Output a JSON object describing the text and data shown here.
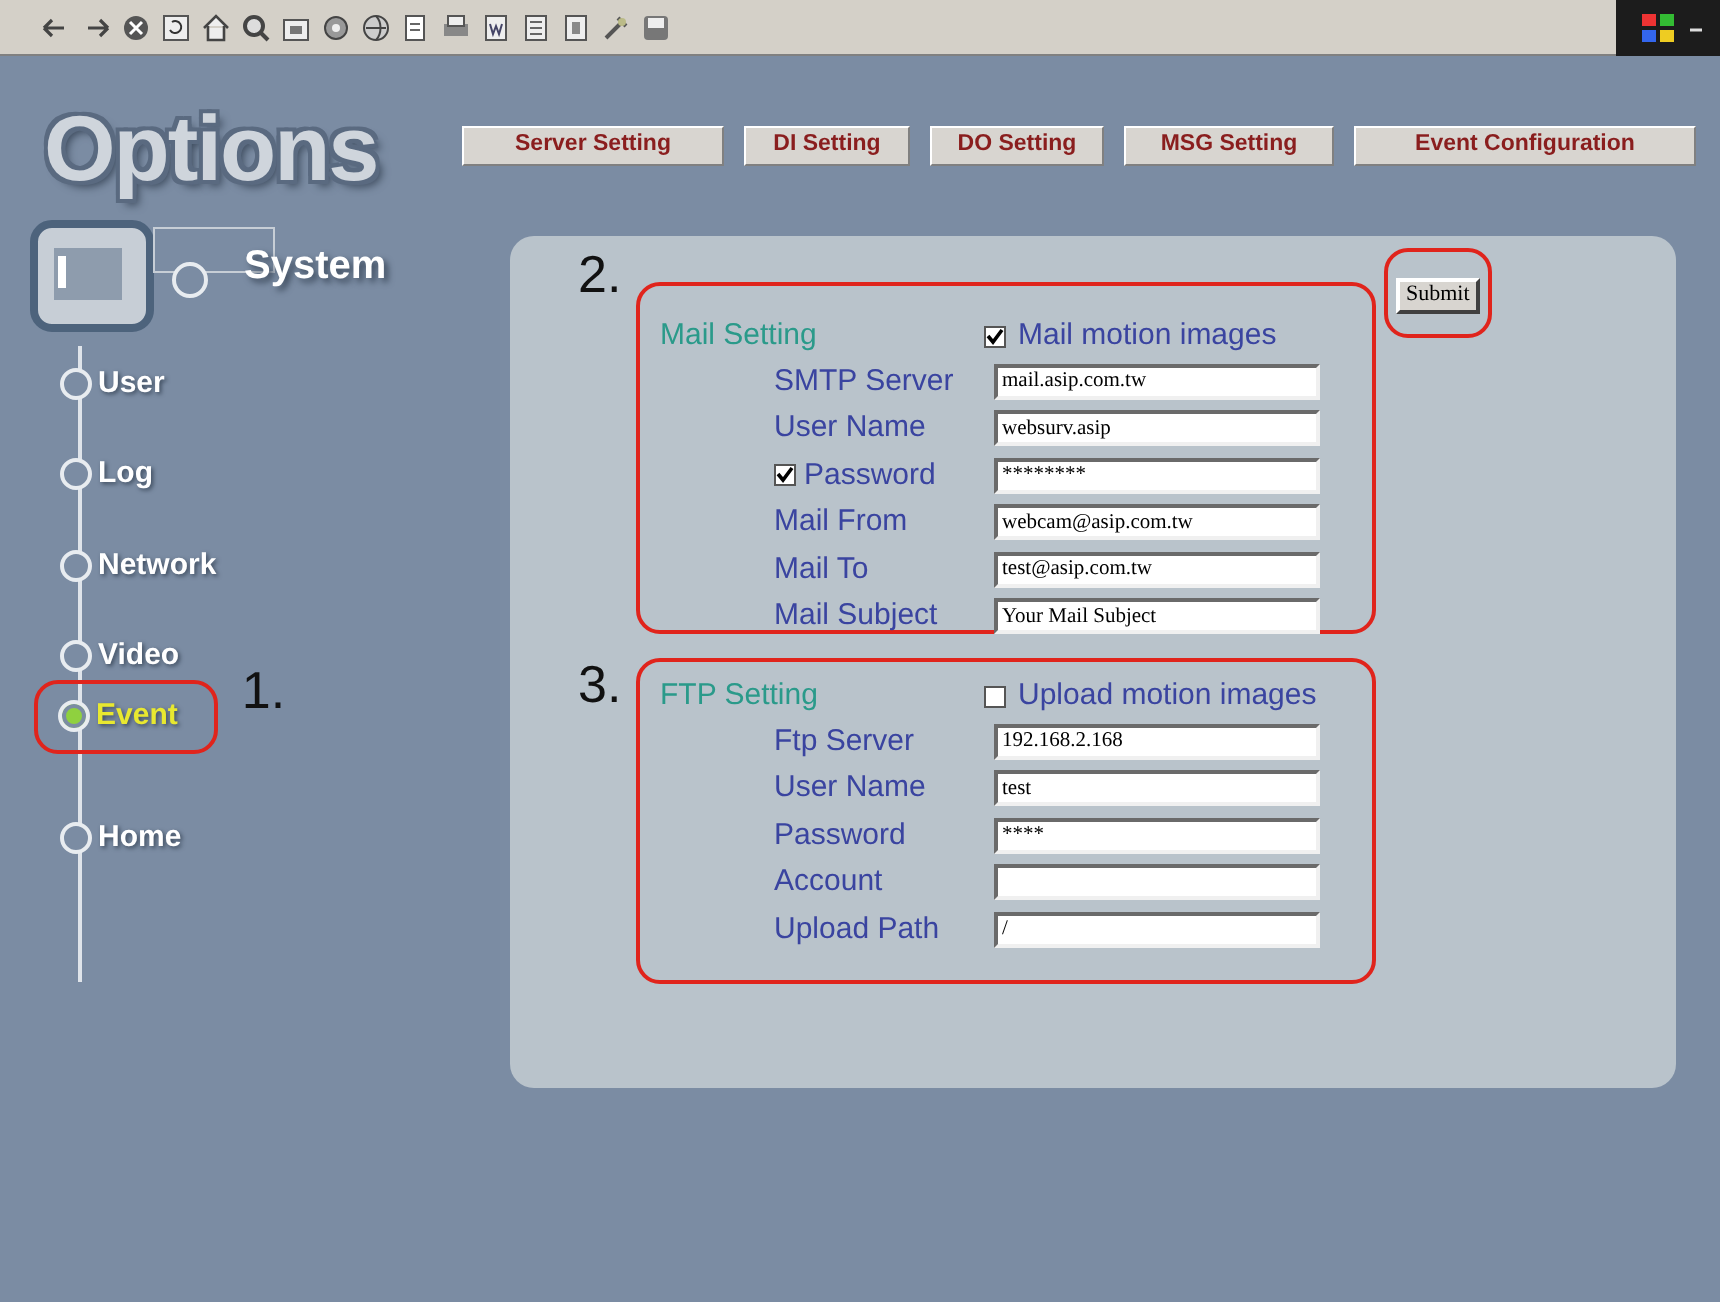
{
  "logo": "Options",
  "system": "System",
  "nav": [
    {
      "label": "User",
      "selected": false
    },
    {
      "label": "Log",
      "selected": false
    },
    {
      "label": "Network",
      "selected": false
    },
    {
      "label": "Video",
      "selected": false
    },
    {
      "label": "Event",
      "selected": true
    },
    {
      "label": "Home",
      "selected": false
    }
  ],
  "tabs": [
    {
      "label": "Server Setting"
    },
    {
      "label": "DI Setting"
    },
    {
      "label": "DO Setting"
    },
    {
      "label": "MSG Setting"
    },
    {
      "label": "Event Configuration"
    }
  ],
  "submit": "Submit",
  "annotations": {
    "nav": "1.",
    "sections": [
      "2.",
      "3."
    ]
  },
  "sections": [
    {
      "title": "Mail Setting",
      "option": {
        "label": "Mail motion images",
        "checked": true
      },
      "fields": [
        {
          "label": "SMTP Server",
          "value": "mail.asip.com.tw"
        },
        {
          "label": "User Name",
          "value": "websurv.asip"
        },
        {
          "label": "Password",
          "value": "********",
          "kind": "checkbox",
          "checked": true
        },
        {
          "label": "Mail From",
          "value": "webcam@asip.com.tw"
        },
        {
          "label": "Mail To",
          "value": "test@asip.com.tw"
        },
        {
          "label": "Mail Subject",
          "value": "Your Mail Subject"
        }
      ]
    },
    {
      "title": "FTP Setting",
      "option": {
        "label": "Upload motion images",
        "checked": false
      },
      "fields": [
        {
          "label": "Ftp Server",
          "value": "192.168.2.168"
        },
        {
          "label": "User Name",
          "value": "test"
        },
        {
          "label": "Password",
          "value": "****"
        },
        {
          "label": "Account"
        },
        {
          "label": "Upload Path",
          "value": "/"
        }
      ]
    }
  ]
}
